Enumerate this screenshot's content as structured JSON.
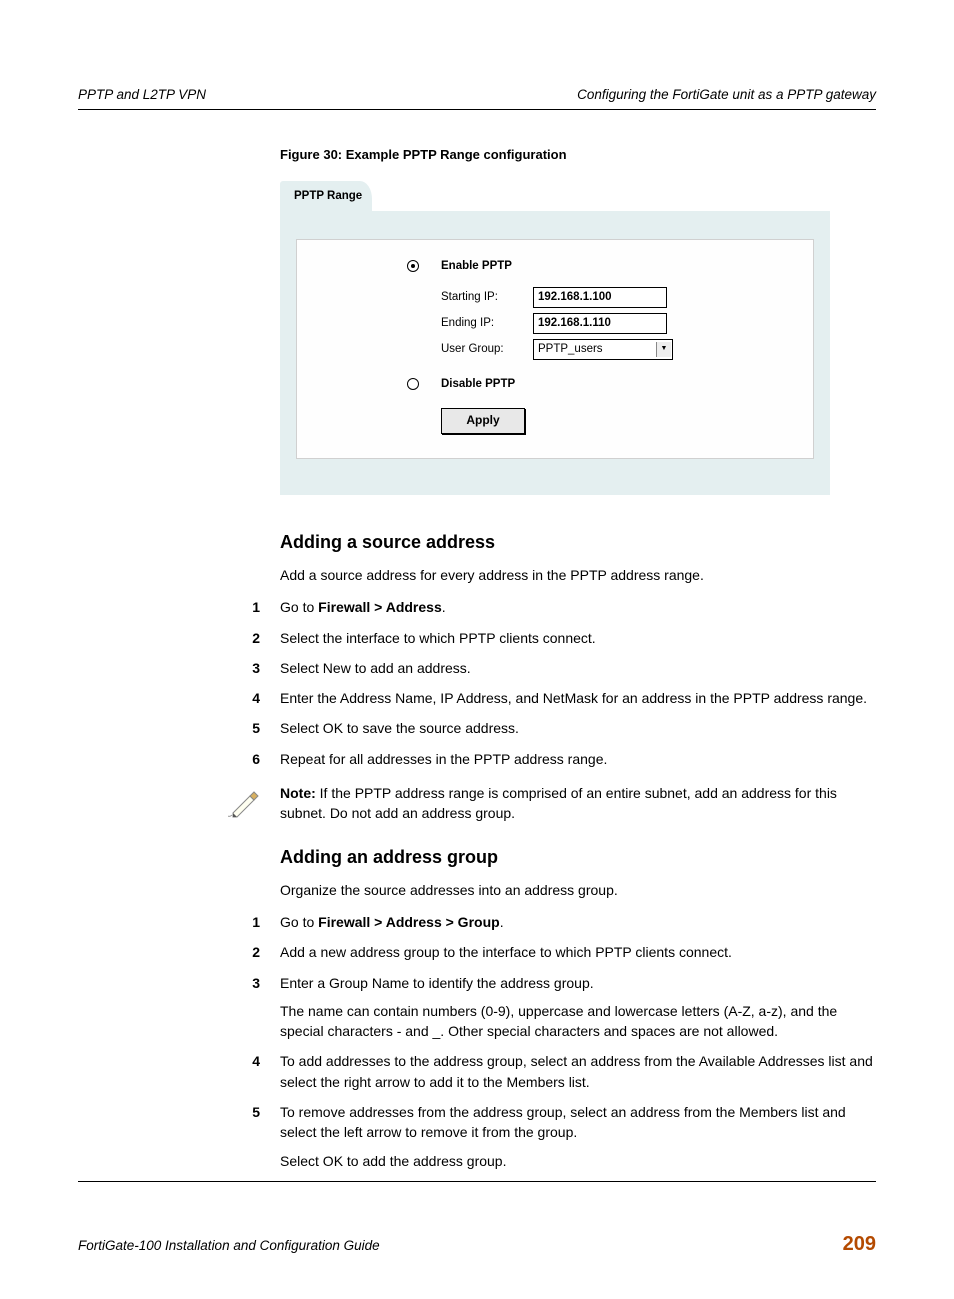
{
  "header": {
    "left": "PPTP and L2TP VPN",
    "right": "Configuring the FortiGate unit as a PPTP gateway"
  },
  "figure": {
    "caption": "Figure 30: Example PPTP Range configuration",
    "tab": "PPTP Range",
    "enable_label": "Enable PPTP",
    "disable_label": "Disable PPTP",
    "fields": {
      "starting_ip_label": "Starting IP:",
      "starting_ip_value": "192.168.1.100",
      "ending_ip_label": "Ending IP:",
      "ending_ip_value": "192.168.1.110",
      "user_group_label": "User Group:",
      "user_group_value": "PPTP_users"
    },
    "apply": "Apply"
  },
  "section1": {
    "heading": "Adding a source address",
    "intro": "Add a source address for every address in the PPTP address range.",
    "steps": {
      "1_pre": "Go to ",
      "1_bold": "Firewall > Address",
      "1_post": ".",
      "2": "Select the interface to which PPTP clients connect.",
      "3": "Select New to add an address.",
      "4": "Enter the Address Name, IP Address, and NetMask for an address in the PPTP address range.",
      "5": "Select OK to save the source address.",
      "6": "Repeat for all addresses in the PPTP address range."
    },
    "note_bold": "Note:",
    "note_text": " If the PPTP address range is comprised of an entire subnet, add an address for this subnet. Do not add an address group."
  },
  "section2": {
    "heading": "Adding an address group",
    "intro": "Organize the source addresses into an address group.",
    "steps": {
      "1_pre": "Go to ",
      "1_bold": "Firewall > Address > Group",
      "1_post": ".",
      "2": "Add a new address group to the interface to which PPTP clients connect.",
      "3a": "Enter a Group Name to identify the address group.",
      "3b": "The name can contain numbers (0-9), uppercase and lowercase letters (A-Z, a-z), and the special characters - and _. Other special characters and spaces are not allowed.",
      "4": "To add addresses to the address group, select an address from the Available Addresses list and select the right arrow to add it to the Members list.",
      "5a": "To remove addresses from the address group, select an address from the Members list and select the left arrow to remove it from the group.",
      "5b": "Select OK to add the address group."
    }
  },
  "footer": {
    "left": "FortiGate-100 Installation and Configuration Guide",
    "page": "209"
  }
}
